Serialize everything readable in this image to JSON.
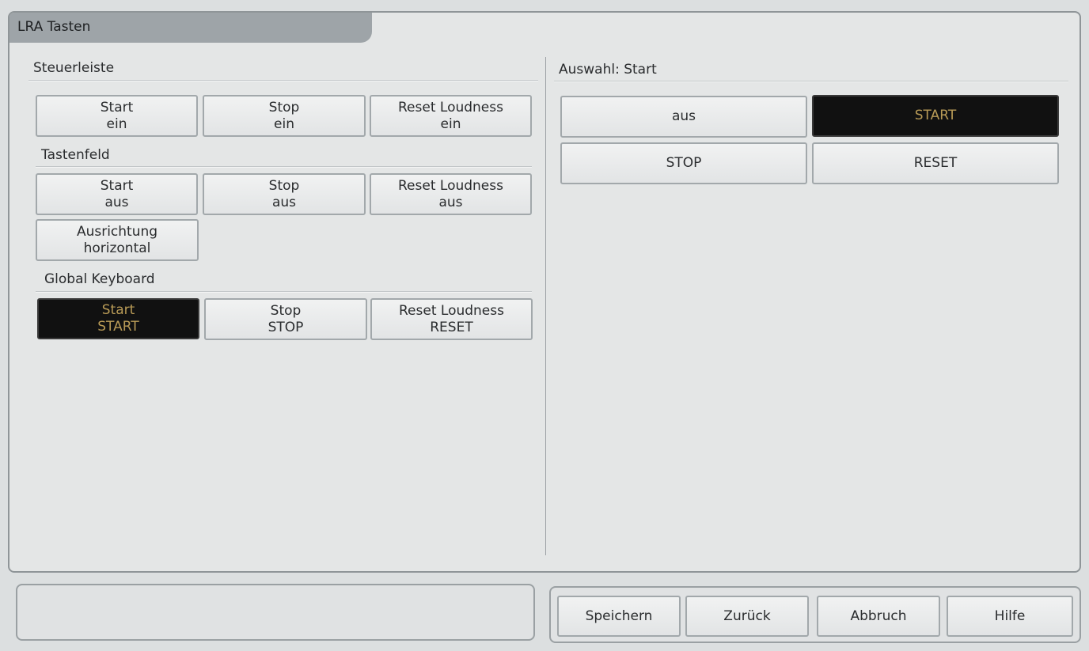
{
  "window": {
    "title": "LRA Tasten"
  },
  "left": {
    "steuerleiste": {
      "label": "Steuerleiste",
      "buttons": [
        {
          "line1": "Start",
          "line2": "ein"
        },
        {
          "line1": "Stop",
          "line2": "ein"
        },
        {
          "line1": "Reset Loudness",
          "line2": "ein"
        }
      ]
    },
    "tastenfeld": {
      "label": "Tastenfeld",
      "buttons": [
        {
          "line1": "Start",
          "line2": "aus"
        },
        {
          "line1": "Stop",
          "line2": "aus"
        },
        {
          "line1": "Reset Loudness",
          "line2": "aus"
        }
      ],
      "orientation": {
        "line1": "Ausrichtung",
        "line2": "horizontal"
      }
    },
    "global_keyboard": {
      "label": "Global Keyboard",
      "buttons": [
        {
          "line1": "Start",
          "line2": "START",
          "selected": true
        },
        {
          "line1": "Stop",
          "line2": "STOP"
        },
        {
          "line1": "Reset Loudness",
          "line2": "RESET"
        }
      ]
    }
  },
  "right": {
    "label": "Auswahl: Start",
    "options": [
      {
        "label": "aus"
      },
      {
        "label": "START",
        "selected": true
      },
      {
        "label": "STOP"
      },
      {
        "label": "RESET"
      }
    ]
  },
  "footer": {
    "save": "Speichern",
    "back": "Zurück",
    "cancel": "Abbruch",
    "help": "Hilfe"
  },
  "colors": {
    "selected_bg": "#111111",
    "selected_text": "#b89a56"
  }
}
